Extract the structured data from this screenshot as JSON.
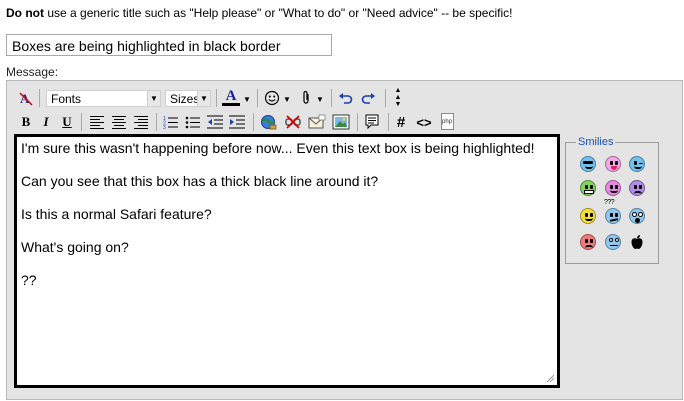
{
  "notice": {
    "bold": "Do not",
    "text": " use a generic title such as \"Help please\" or \"What to do\" or \"Need advice\" -- be specific!"
  },
  "title_field": {
    "value": "Boxes are being highlighted in black border"
  },
  "message_label": "Message:",
  "toolbar": {
    "fonts_label": "Fonts",
    "sizes_label": "Sizes",
    "bold": "B",
    "italic": "I",
    "underline": "U",
    "code": "#",
    "html": "<>",
    "php": "php",
    "font_color_letter": "A"
  },
  "message_lines": [
    "I'm sure this wasn't happening before now... Even this text box is being highlighted!",
    "",
    "Can you see that this box has a thick black line around it?",
    "",
    "Is this a normal Safari feature?",
    "",
    "What's going on?",
    "",
    "??"
  ],
  "smilies": {
    "legend": "Smilies",
    "confused_label": "???"
  },
  "colors": {
    "background": "#ffffff",
    "editor_bg": "#e4e4e4",
    "textarea_border": "#000000",
    "smilies_legend": "#1a4fb5"
  }
}
